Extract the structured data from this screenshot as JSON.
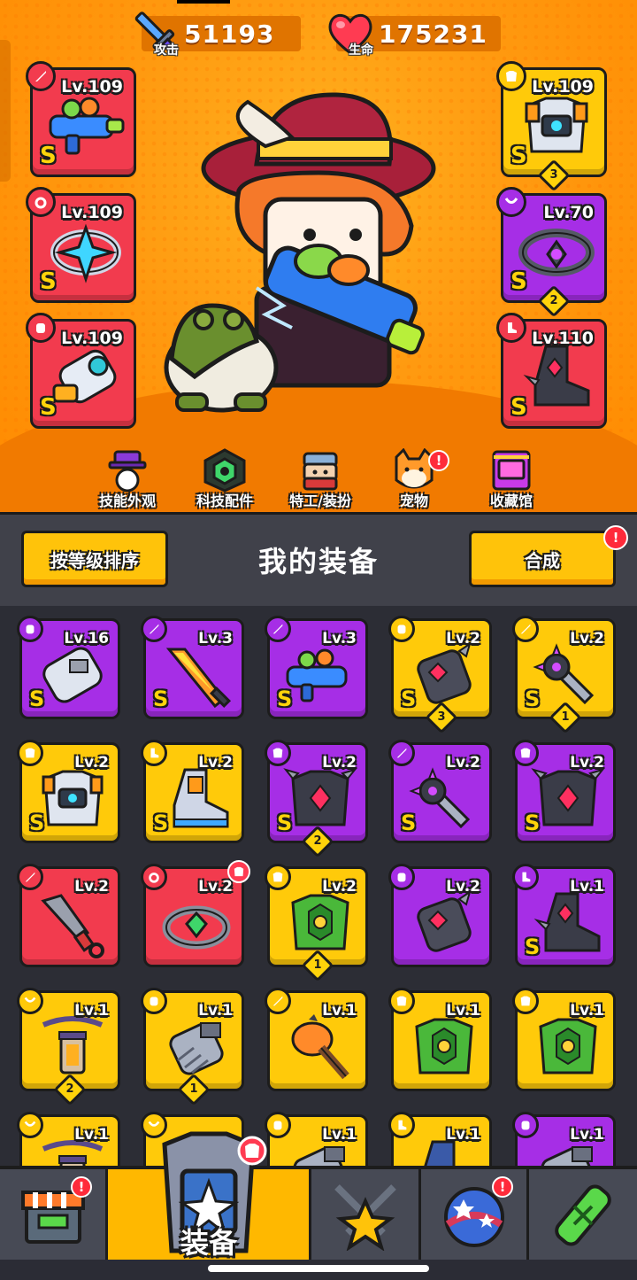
{
  "stats": {
    "attack": {
      "label": "攻击",
      "value": "51193",
      "icon": "sword-icon"
    },
    "health": {
      "label": "生命",
      "value": "175231",
      "icon": "heart-icon"
    }
  },
  "equipped_left": [
    {
      "level": "Lv.109",
      "rank": "S",
      "rarity": "red",
      "slot": "weapon",
      "item": "water-blaster"
    },
    {
      "level": "Lv.109",
      "rank": "S",
      "rarity": "red",
      "slot": "ring",
      "item": "star-ring"
    },
    {
      "level": "Lv.109",
      "rank": "S",
      "rarity": "red",
      "slot": "gloves",
      "item": "power-gauntlet"
    }
  ],
  "equipped_right": [
    {
      "level": "Lv.109",
      "rank": "S",
      "rarity": "yellow",
      "slot": "armor",
      "item": "mech-armor",
      "count": "3"
    },
    {
      "level": "Lv.70",
      "rank": "S",
      "rarity": "purple",
      "slot": "necklace",
      "item": "spiked-collar",
      "count": "2"
    },
    {
      "level": "Lv.110",
      "rank": "S",
      "rarity": "red",
      "slot": "boots",
      "item": "spiked-boots"
    }
  ],
  "hero_menu": [
    {
      "label": "技能外观",
      "icon": "skin-icon"
    },
    {
      "label": "科技配件",
      "icon": "tech-part-icon"
    },
    {
      "label": "特工/装扮",
      "icon": "agent-icon"
    },
    {
      "label": "宠物",
      "icon": "pet-icon",
      "badge": "!"
    },
    {
      "label": "收藏馆",
      "icon": "collection-icon"
    }
  ],
  "inventory": {
    "title": "我的装备",
    "sort_button": "按等级排序",
    "merge_button": "合成",
    "merge_badge": "!",
    "items": [
      {
        "level": "Lv.16",
        "rank": "S",
        "rarity": "purple",
        "slot": "gloves",
        "item": "gauntlet"
      },
      {
        "level": "Lv.3",
        "rank": "S",
        "rarity": "purple",
        "slot": "weapon",
        "item": "flame-sword"
      },
      {
        "level": "Lv.3",
        "rank": "S",
        "rarity": "purple",
        "slot": "weapon",
        "item": "water-blaster"
      },
      {
        "level": "Lv.2",
        "rank": "S",
        "rarity": "yellow",
        "slot": "gloves",
        "item": "claw-glove",
        "count": "3"
      },
      {
        "level": "Lv.2",
        "rank": "S",
        "rarity": "yellow",
        "slot": "weapon",
        "item": "spiked-blade",
        "count": "1"
      },
      {
        "level": "Lv.2",
        "rank": "S",
        "rarity": "yellow",
        "slot": "armor",
        "item": "mech-armor"
      },
      {
        "level": "Lv.2",
        "rank": "S",
        "rarity": "yellow",
        "slot": "boots",
        "item": "mech-boots"
      },
      {
        "level": "Lv.2",
        "rank": "S",
        "rarity": "purple",
        "slot": "armor",
        "item": "dark-armor",
        "count": "2"
      },
      {
        "level": "Lv.2",
        "rank": "S",
        "rarity": "purple",
        "slot": "weapon",
        "item": "spiked-blade"
      },
      {
        "level": "Lv.2",
        "rank": "S",
        "rarity": "purple",
        "slot": "armor",
        "item": "dark-armor"
      },
      {
        "level": "Lv.2",
        "rank": "",
        "rarity": "red",
        "slot": "weapon",
        "item": "kunai"
      },
      {
        "level": "Lv.2",
        "rank": "",
        "rarity": "red",
        "slot": "ring",
        "item": "emerald-ring",
        "corner": "armor"
      },
      {
        "level": "Lv.2",
        "rank": "",
        "rarity": "yellow",
        "slot": "armor",
        "item": "leaf-armor",
        "count": "1"
      },
      {
        "level": "Lv.2",
        "rank": "",
        "rarity": "purple",
        "slot": "gloves",
        "item": "claw-glove"
      },
      {
        "level": "Lv.1",
        "rank": "S",
        "rarity": "purple",
        "slot": "boots",
        "item": "spiked-boots"
      },
      {
        "level": "Lv.1",
        "rank": "",
        "rarity": "yellow",
        "slot": "necklace",
        "item": "lantern-chain",
        "count": "2"
      },
      {
        "level": "Lv.1",
        "rank": "",
        "rarity": "yellow",
        "slot": "gloves",
        "item": "iron-glove",
        "count": "1"
      },
      {
        "level": "Lv.1",
        "rank": "",
        "rarity": "yellow",
        "slot": "weapon",
        "item": "club"
      },
      {
        "level": "Lv.1",
        "rank": "",
        "rarity": "yellow",
        "slot": "armor",
        "item": "leaf-armor"
      },
      {
        "level": "Lv.1",
        "rank": "",
        "rarity": "yellow",
        "slot": "armor",
        "item": "leaf-armor"
      },
      {
        "level": "Lv.1",
        "rank": "",
        "rarity": "yellow",
        "slot": "necklace",
        "item": "lantern-chain"
      },
      {
        "level": "",
        "rank": "",
        "rarity": "yellow",
        "slot": "necklace",
        "item": "ring-chain"
      },
      {
        "level": "Lv.1",
        "rank": "",
        "rarity": "yellow",
        "slot": "gloves",
        "item": "iron-glove"
      },
      {
        "level": "Lv.1",
        "rank": "",
        "rarity": "yellow",
        "slot": "boots",
        "item": "boot"
      },
      {
        "level": "Lv.1",
        "rank": "",
        "rarity": "purple",
        "slot": "gloves",
        "item": "iron-glove"
      }
    ]
  },
  "bottom_nav": {
    "active_label": "装备",
    "tabs": [
      {
        "name": "shop",
        "icon": "shop-icon",
        "badge": "!"
      },
      {
        "name": "equipment",
        "icon": "armor-chest-icon",
        "badge": "armor"
      },
      {
        "name": "battle",
        "icon": "crossed-swords-star-icon"
      },
      {
        "name": "world",
        "icon": "planet-icon",
        "badge": "!"
      },
      {
        "name": "lab",
        "icon": "dna-capsule-icon"
      }
    ]
  },
  "colors": {
    "red": "#f23b4e",
    "purple": "#a62ee6",
    "yellow": "#ffca0a",
    "background_orange": "#ff9a10",
    "panel_dark": "#2c2d35"
  }
}
